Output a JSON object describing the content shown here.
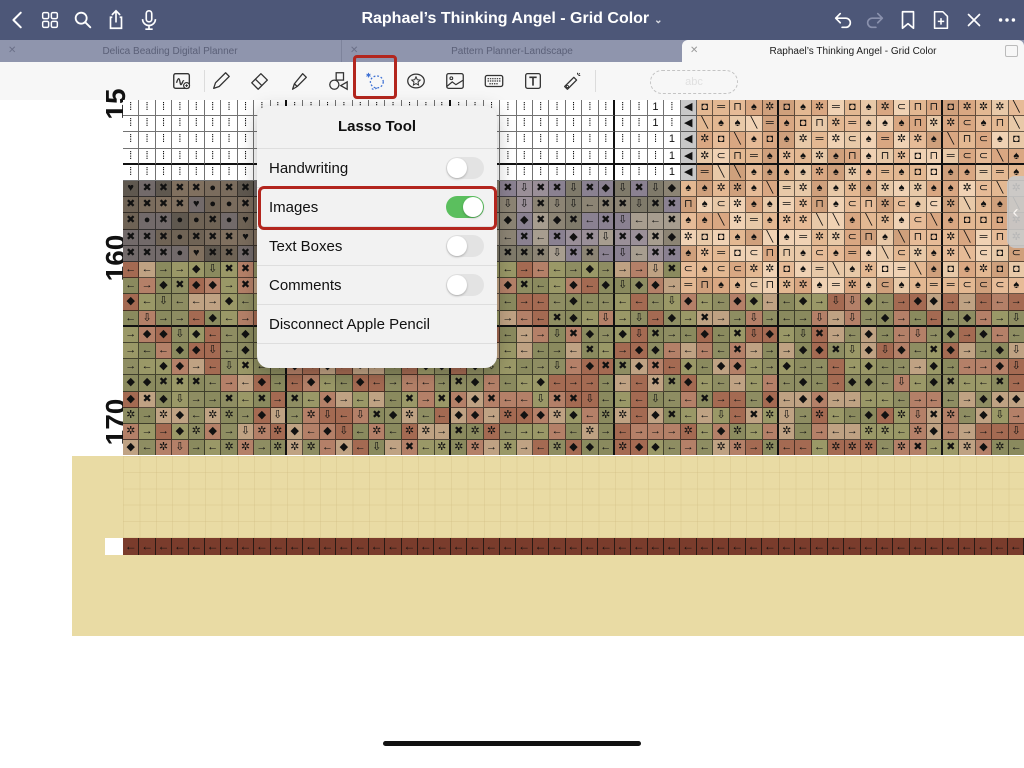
{
  "topbar": {
    "title": "Raphael’s Thinking Angel - Grid Color",
    "left_icons": [
      "back-icon",
      "grid-view-icon",
      "search-icon",
      "share-icon",
      "microphone-icon"
    ],
    "right_icons": [
      "undo-icon",
      "redo-icon",
      "bookmark-icon",
      "add-page-icon",
      "close-icon",
      "more-icon"
    ]
  },
  "tabs": [
    {
      "label": "Delica Beading Digital Planner",
      "active": false
    },
    {
      "label": "Pattern Planner-Landscape",
      "active": false
    },
    {
      "label": "Raphael’s Thinking Angel - Grid Color",
      "active": true
    }
  ],
  "toolbar": {
    "tools": [
      "zoom-window",
      "pen",
      "eraser",
      "highlighter",
      "shapes",
      "lasso",
      "elements",
      "image",
      "keyboard",
      "text-box",
      "laser-pointer"
    ],
    "selected_tool": "lasso",
    "handwriting_pill_text": "abc"
  },
  "page": {
    "row_labels": [
      "15",
      "160",
      "170"
    ]
  },
  "popover": {
    "title": "Lasso Tool",
    "items": [
      {
        "label": "Handwriting",
        "toggle": false
      },
      {
        "label": "Images",
        "toggle": true
      },
      {
        "label": "Text Boxes",
        "toggle": false
      },
      {
        "label": "Comments",
        "toggle": false
      },
      {
        "label": "Disconnect Apple Pencil"
      }
    ]
  },
  "colors": {
    "topbar": "#4d5778",
    "highlight_red": "#b3261e",
    "toggle_on": "#5bbf5e",
    "page_band": "#e9dba4"
  }
}
